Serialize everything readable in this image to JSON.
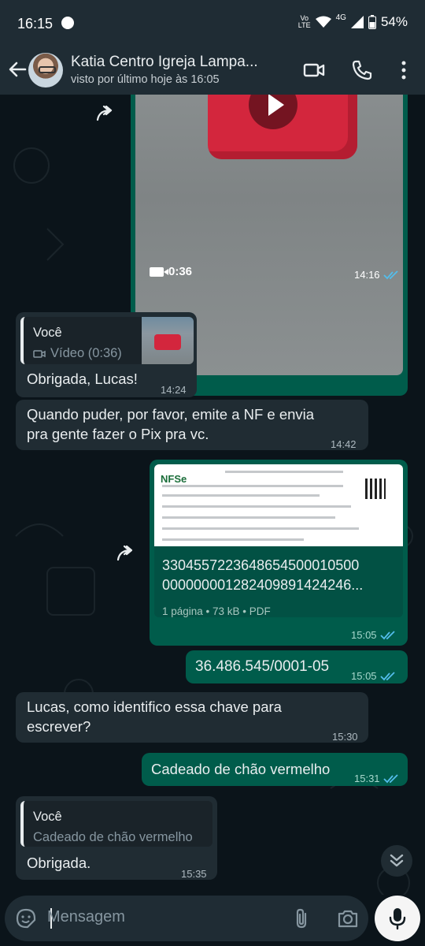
{
  "status_bar": {
    "time": "16:15",
    "network_top": "Vo",
    "network_bottom": "LTE",
    "gen": "4G",
    "battery": "54%"
  },
  "header": {
    "contact_name": "Katia Centro Igreja Lampa...",
    "last_seen": "visto por último hoje às 16:05"
  },
  "messages": {
    "video": {
      "duration": "0:36",
      "time": "14:16"
    },
    "reply1": {
      "quote_author": "Você",
      "quote_text": "Vídeo (0:36)",
      "text": "Obrigada, Lucas!",
      "time": "14:24"
    },
    "msg2": {
      "line1": "Quando puder, por favor, emite a NF e envia",
      "line2": "pra gente fazer o Pix pra vc.",
      "time": "14:42"
    },
    "doc": {
      "logo": "NFSe",
      "name_line1": "330455722364865450001050​0",
      "name_line2": "00000000128240989142424​6...",
      "info": "1 página • 73 kB • PDF",
      "time": "15:05"
    },
    "cnpj": {
      "text": "36.486.545/0001-05",
      "time": "15:05"
    },
    "question": {
      "line1": "Lucas, como identifico essa chave para",
      "line2": "escrever?",
      "time": "15:30"
    },
    "answer": {
      "text": "Cadeado de chão vermelho",
      "time": "15:31"
    },
    "reply2": {
      "quote_author": "Você",
      "quote_text": "Cadeado de chão vermelho",
      "text": "Obrigada.",
      "time": "15:35"
    }
  },
  "input": {
    "placeholder": "Mensagem"
  },
  "colors": {
    "background": "#0b141a",
    "incoming": "#202c33",
    "outgoing": "#005c4b",
    "header": "#1f2c34",
    "read_ticks": "#53bdeb"
  }
}
